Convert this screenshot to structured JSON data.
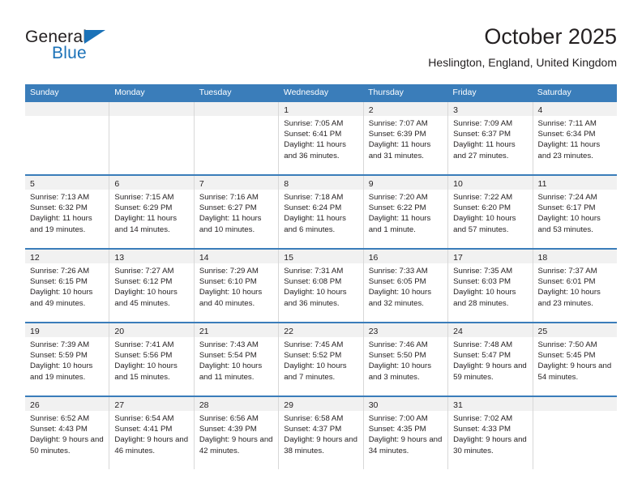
{
  "brand": {
    "name_part1": "General",
    "name_part2": "Blue",
    "triangle_color": "#1b72b8"
  },
  "header": {
    "title": "October 2025",
    "subtitle": "Heslington, England, United Kingdom"
  },
  "theme": {
    "header_blue": "#3a7dba",
    "date_band": "#f1f1f1",
    "text": "#231f20",
    "cell_border": "#d8d8d8"
  },
  "weekdays": [
    "Sunday",
    "Monday",
    "Tuesday",
    "Wednesday",
    "Thursday",
    "Friday",
    "Saturday"
  ],
  "weeks": [
    [
      {
        "date": "",
        "empty": true
      },
      {
        "date": "",
        "empty": true
      },
      {
        "date": "",
        "empty": true
      },
      {
        "date": "1",
        "sunrise": "Sunrise: 7:05 AM",
        "sunset": "Sunset: 6:41 PM",
        "daylight": "Daylight: 11 hours and 36 minutes."
      },
      {
        "date": "2",
        "sunrise": "Sunrise: 7:07 AM",
        "sunset": "Sunset: 6:39 PM",
        "daylight": "Daylight: 11 hours and 31 minutes."
      },
      {
        "date": "3",
        "sunrise": "Sunrise: 7:09 AM",
        "sunset": "Sunset: 6:37 PM",
        "daylight": "Daylight: 11 hours and 27 minutes."
      },
      {
        "date": "4",
        "sunrise": "Sunrise: 7:11 AM",
        "sunset": "Sunset: 6:34 PM",
        "daylight": "Daylight: 11 hours and 23 minutes."
      }
    ],
    [
      {
        "date": "5",
        "sunrise": "Sunrise: 7:13 AM",
        "sunset": "Sunset: 6:32 PM",
        "daylight": "Daylight: 11 hours and 19 minutes."
      },
      {
        "date": "6",
        "sunrise": "Sunrise: 7:15 AM",
        "sunset": "Sunset: 6:29 PM",
        "daylight": "Daylight: 11 hours and 14 minutes."
      },
      {
        "date": "7",
        "sunrise": "Sunrise: 7:16 AM",
        "sunset": "Sunset: 6:27 PM",
        "daylight": "Daylight: 11 hours and 10 minutes."
      },
      {
        "date": "8",
        "sunrise": "Sunrise: 7:18 AM",
        "sunset": "Sunset: 6:24 PM",
        "daylight": "Daylight: 11 hours and 6 minutes."
      },
      {
        "date": "9",
        "sunrise": "Sunrise: 7:20 AM",
        "sunset": "Sunset: 6:22 PM",
        "daylight": "Daylight: 11 hours and 1 minute."
      },
      {
        "date": "10",
        "sunrise": "Sunrise: 7:22 AM",
        "sunset": "Sunset: 6:20 PM",
        "daylight": "Daylight: 10 hours and 57 minutes."
      },
      {
        "date": "11",
        "sunrise": "Sunrise: 7:24 AM",
        "sunset": "Sunset: 6:17 PM",
        "daylight": "Daylight: 10 hours and 53 minutes."
      }
    ],
    [
      {
        "date": "12",
        "sunrise": "Sunrise: 7:26 AM",
        "sunset": "Sunset: 6:15 PM",
        "daylight": "Daylight: 10 hours and 49 minutes."
      },
      {
        "date": "13",
        "sunrise": "Sunrise: 7:27 AM",
        "sunset": "Sunset: 6:12 PM",
        "daylight": "Daylight: 10 hours and 45 minutes."
      },
      {
        "date": "14",
        "sunrise": "Sunrise: 7:29 AM",
        "sunset": "Sunset: 6:10 PM",
        "daylight": "Daylight: 10 hours and 40 minutes."
      },
      {
        "date": "15",
        "sunrise": "Sunrise: 7:31 AM",
        "sunset": "Sunset: 6:08 PM",
        "daylight": "Daylight: 10 hours and 36 minutes."
      },
      {
        "date": "16",
        "sunrise": "Sunrise: 7:33 AM",
        "sunset": "Sunset: 6:05 PM",
        "daylight": "Daylight: 10 hours and 32 minutes."
      },
      {
        "date": "17",
        "sunrise": "Sunrise: 7:35 AM",
        "sunset": "Sunset: 6:03 PM",
        "daylight": "Daylight: 10 hours and 28 minutes."
      },
      {
        "date": "18",
        "sunrise": "Sunrise: 7:37 AM",
        "sunset": "Sunset: 6:01 PM",
        "daylight": "Daylight: 10 hours and 23 minutes."
      }
    ],
    [
      {
        "date": "19",
        "sunrise": "Sunrise: 7:39 AM",
        "sunset": "Sunset: 5:59 PM",
        "daylight": "Daylight: 10 hours and 19 minutes."
      },
      {
        "date": "20",
        "sunrise": "Sunrise: 7:41 AM",
        "sunset": "Sunset: 5:56 PM",
        "daylight": "Daylight: 10 hours and 15 minutes."
      },
      {
        "date": "21",
        "sunrise": "Sunrise: 7:43 AM",
        "sunset": "Sunset: 5:54 PM",
        "daylight": "Daylight: 10 hours and 11 minutes."
      },
      {
        "date": "22",
        "sunrise": "Sunrise: 7:45 AM",
        "sunset": "Sunset: 5:52 PM",
        "daylight": "Daylight: 10 hours and 7 minutes."
      },
      {
        "date": "23",
        "sunrise": "Sunrise: 7:46 AM",
        "sunset": "Sunset: 5:50 PM",
        "daylight": "Daylight: 10 hours and 3 minutes."
      },
      {
        "date": "24",
        "sunrise": "Sunrise: 7:48 AM",
        "sunset": "Sunset: 5:47 PM",
        "daylight": "Daylight: 9 hours and 59 minutes."
      },
      {
        "date": "25",
        "sunrise": "Sunrise: 7:50 AM",
        "sunset": "Sunset: 5:45 PM",
        "daylight": "Daylight: 9 hours and 54 minutes."
      }
    ],
    [
      {
        "date": "26",
        "sunrise": "Sunrise: 6:52 AM",
        "sunset": "Sunset: 4:43 PM",
        "daylight": "Daylight: 9 hours and 50 minutes."
      },
      {
        "date": "27",
        "sunrise": "Sunrise: 6:54 AM",
        "sunset": "Sunset: 4:41 PM",
        "daylight": "Daylight: 9 hours and 46 minutes."
      },
      {
        "date": "28",
        "sunrise": "Sunrise: 6:56 AM",
        "sunset": "Sunset: 4:39 PM",
        "daylight": "Daylight: 9 hours and 42 minutes."
      },
      {
        "date": "29",
        "sunrise": "Sunrise: 6:58 AM",
        "sunset": "Sunset: 4:37 PM",
        "daylight": "Daylight: 9 hours and 38 minutes."
      },
      {
        "date": "30",
        "sunrise": "Sunrise: 7:00 AM",
        "sunset": "Sunset: 4:35 PM",
        "daylight": "Daylight: 9 hours and 34 minutes."
      },
      {
        "date": "31",
        "sunrise": "Sunrise: 7:02 AM",
        "sunset": "Sunset: 4:33 PM",
        "daylight": "Daylight: 9 hours and 30 minutes."
      },
      {
        "date": "",
        "empty": true
      }
    ]
  ]
}
